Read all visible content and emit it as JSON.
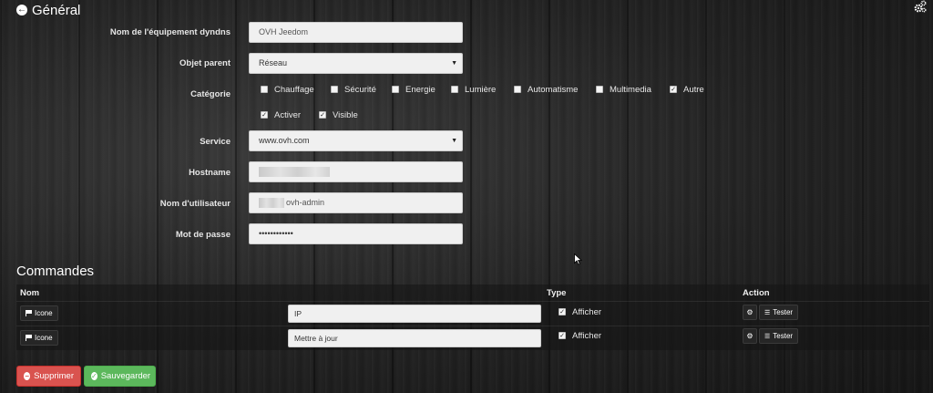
{
  "header": {
    "title": "Général",
    "back_icon": "arrow-circle-left-icon",
    "settings_icon": "gears-icon"
  },
  "form": {
    "name": {
      "label": "Nom de l'équipement dyndns",
      "value": "OVH Jeedom"
    },
    "parent": {
      "label": "Objet parent",
      "value": "Réseau"
    },
    "category": {
      "label": "Catégorie",
      "options": [
        {
          "label": "Chauffage",
          "checked": false
        },
        {
          "label": "Sécurité",
          "checked": false
        },
        {
          "label": "Energie",
          "checked": false
        },
        {
          "label": "Lumière",
          "checked": false
        },
        {
          "label": "Automatisme",
          "checked": false
        },
        {
          "label": "Multimedia",
          "checked": false
        },
        {
          "label": "Autre",
          "checked": true
        }
      ],
      "activate": {
        "label": "Activer",
        "checked": true
      },
      "visible": {
        "label": "Visible",
        "checked": true
      }
    },
    "service": {
      "label": "Service",
      "value": "www.ovh.com"
    },
    "hostname": {
      "label": "Hostname",
      "value": ""
    },
    "username": {
      "label": "Nom d'utilisateur",
      "value": "ovh-admin"
    },
    "password": {
      "label": "Mot de passe",
      "value": "••••••••••••"
    }
  },
  "commands": {
    "title": "Commandes",
    "columns": {
      "name": "Nom",
      "type": "Type",
      "action": "Action"
    },
    "rows": [
      {
        "icon_label": "Icone",
        "name": "IP",
        "show_label": "Afficher",
        "show_checked": true,
        "test_label": "Tester"
      },
      {
        "icon_label": "Icone",
        "name": "Mettre à jour",
        "show_label": "Afficher",
        "show_checked": true,
        "test_label": "Tester"
      }
    ]
  },
  "actions": {
    "delete_label": "Supprimer",
    "save_label": "Sauvegarder"
  },
  "colors": {
    "delete": "#d9534f",
    "save": "#5cb85c"
  }
}
